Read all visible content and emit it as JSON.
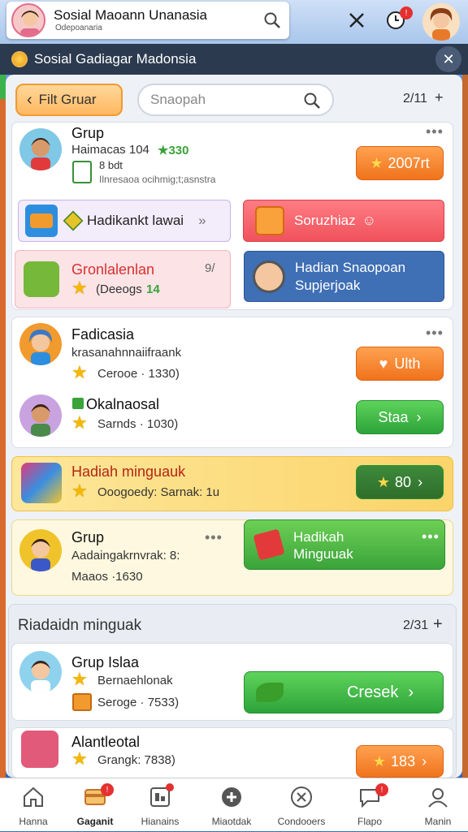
{
  "topbar": {
    "title": "Sosial Maoann Unanasia",
    "subtitle": "Odepoanaria"
  },
  "banner": {
    "title": "Sosial Gadiagar Madonsia"
  },
  "toolbar": {
    "filter_label": "Filt Gruar",
    "search_placeholder": "Snaopah",
    "count": "2/11"
  },
  "groups": [
    {
      "name": "Grup",
      "line1": "Haimacas 104",
      "line1_tag": "★330",
      "line2": "8 bdt",
      "line3": "Ilnresaoa ocihmig;t;asnstra",
      "button": "2007rt"
    },
    {
      "name": "Fadicasia",
      "line1": "krasanahnnaiifraank",
      "line2": "Cerooe · 1330)",
      "button": "Ulth"
    },
    {
      "name": "Okalnaosal",
      "line1": "",
      "line2": "Sarnds · 1030)",
      "button": "Staa"
    },
    {
      "name": "Grup",
      "line1": "Aadaingakrnvrak: 8:",
      "line2": "Maaos ·1630"
    },
    {
      "name": "Grup Islaa",
      "line1": "Bernaehlonak",
      "line2": "Seroge · 7533)",
      "button": "Cresek"
    },
    {
      "name": "Alantleotal",
      "line1": "Grangk: 7838)",
      "button": "183"
    }
  ],
  "tiles": {
    "purple": "Hadikankt lawai",
    "red": "Soruzhiaz",
    "pink_title": "Gronlalenlan",
    "pink_sub": "(Deeogs",
    "pink_tag": "14",
    "pink_count": "9/",
    "blue_line1": "Hadian Snaopoan",
    "blue_line2": "Supjerjoak"
  },
  "yellow_card": {
    "title": "Hadiah minguauk",
    "sub": "Ooogoedy: Sarnak: 1u",
    "button": "80"
  },
  "green_card": {
    "line1": "Hadikah",
    "line2": "Minguuak"
  },
  "section": {
    "title": "Riadaidn minguak",
    "count": "2/31"
  },
  "nav": [
    {
      "label": "Hanna"
    },
    {
      "label": "Gaganit"
    },
    {
      "label": "Hianains"
    },
    {
      "label": "Miaotdak"
    },
    {
      "label": "Condooers"
    },
    {
      "label": "Flapo"
    },
    {
      "label": "Manin"
    }
  ],
  "colors": {
    "accent_orange": "#f0731c",
    "accent_green": "#2ea33a",
    "dark_bar": "#2b3a4f",
    "badge_red": "#e53030"
  }
}
